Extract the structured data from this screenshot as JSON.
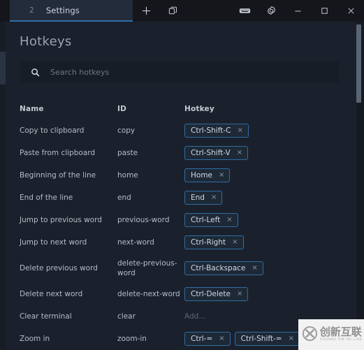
{
  "window": {
    "tab": {
      "index": "2",
      "title": "Settings"
    },
    "actions": [
      {
        "name": "new-tab-button",
        "icon": "plus-icon"
      },
      {
        "name": "split-pane-button",
        "icon": "copy-windows-icon"
      },
      {
        "name": "keyboard-button",
        "icon": "keyboard-icon"
      },
      {
        "name": "settings-button",
        "icon": "gear-icon"
      },
      {
        "name": "minimize-button",
        "icon": "minimize-icon"
      },
      {
        "name": "maximize-button",
        "icon": "maximize-icon"
      },
      {
        "name": "close-button",
        "icon": "close-icon"
      }
    ]
  },
  "page": {
    "title": "Hotkeys"
  },
  "search": {
    "placeholder": "Search hotkeys",
    "value": "",
    "icon": "search-icon"
  },
  "table": {
    "headers": {
      "name": "Name",
      "id": "ID",
      "hotkey": "Hotkey"
    },
    "add_placeholder": "Add...",
    "remove_glyph": "×",
    "rows": [
      {
        "name": "Copy to clipboard",
        "id": "copy",
        "keys": [
          "Ctrl-Shift-C"
        ]
      },
      {
        "name": "Paste from clipboard",
        "id": "paste",
        "keys": [
          "Ctrl-Shift-V"
        ]
      },
      {
        "name": "Beginning of the line",
        "id": "home",
        "keys": [
          "Home"
        ]
      },
      {
        "name": "End of the line",
        "id": "end",
        "keys": [
          "End"
        ]
      },
      {
        "name": "Jump to previous word",
        "id": "previous-word",
        "keys": [
          "Ctrl-Left"
        ]
      },
      {
        "name": "Jump to next word",
        "id": "next-word",
        "keys": [
          "Ctrl-Right"
        ]
      },
      {
        "name": "Delete previous word",
        "id": "delete-previous-word",
        "keys": [
          "Ctrl-Backspace"
        ]
      },
      {
        "name": "Delete next word",
        "id": "delete-next-word",
        "keys": [
          "Ctrl-Delete"
        ]
      },
      {
        "name": "Clear terminal",
        "id": "clear",
        "keys": []
      },
      {
        "name": "Zoom in",
        "id": "zoom-in",
        "keys": [
          "Ctrl-=",
          "Ctrl-Shift-="
        ]
      }
    ]
  },
  "watermark": {
    "cn": "创新互联",
    "en": "CHUANG XIN HU LIAN"
  },
  "colors": {
    "window_chrome": "#14161c",
    "panel": "#1b212c",
    "tab_active": "#232c3b",
    "accent": "#2f6ea8",
    "chip_border": "#2e6da4",
    "chip_fill": "#1d2936",
    "text_primary": "#cfd6df",
    "text_muted": "#6d7784"
  }
}
